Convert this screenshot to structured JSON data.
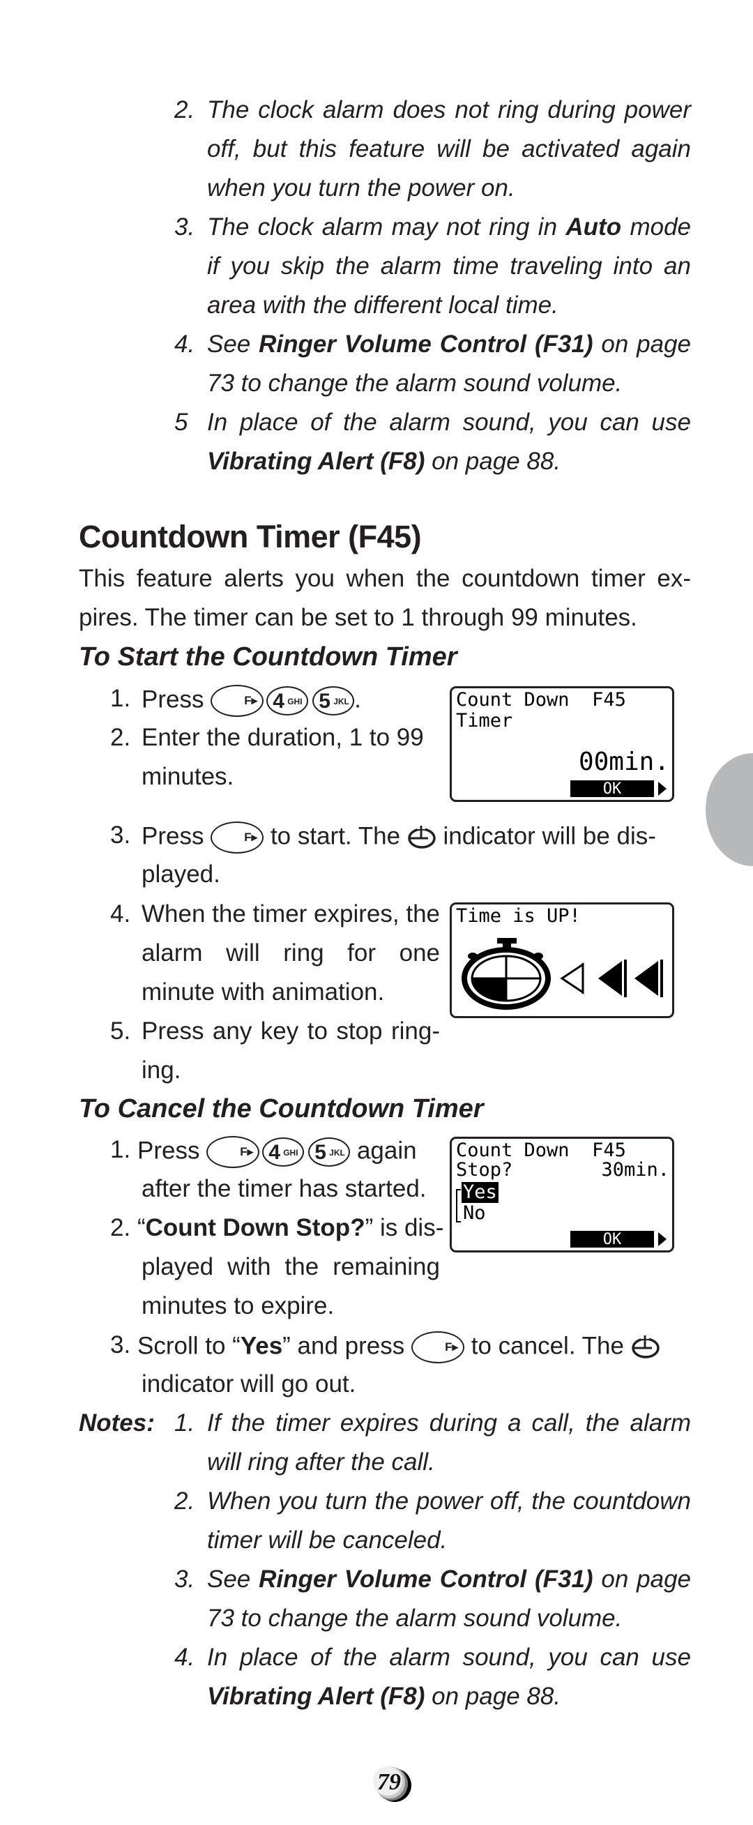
{
  "top_notes": [
    {
      "number": "2.",
      "lines": [
        "The clock alarm does not ring during power",
        "off, but this feature will be activated again",
        "when you turn the power on."
      ]
    },
    {
      "number": "3.",
      "lines_rich": [
        [
          {
            "t": "The clock alarm may not ring in "
          },
          {
            "t": "Auto",
            "b": true
          },
          {
            "t": " mode"
          }
        ],
        [
          {
            "t": "if you skip the alarm time traveling into an"
          }
        ],
        [
          {
            "t": "area with the different local time."
          }
        ]
      ]
    },
    {
      "number": "4.",
      "line1_pre": "See ",
      "line1_bold": "Ringer Volume Control (F31)",
      "line1_post": " on page",
      "line2": "73 to change the alarm sound volume."
    },
    {
      "number": "5",
      "line1": "In place of the alarm sound, you can use",
      "line2_bold": "Vibrating Alert (F8)",
      "line2_post": " on page 88."
    }
  ],
  "section": {
    "title": "Countdown Timer (F45)",
    "intro_line1": "This feature alerts you when the countdown timer ex-",
    "intro_line2": "pires. The timer can be set to 1 through 99 minutes."
  },
  "start": {
    "heading": "To Start the Countdown Timer",
    "step1_num": "1.",
    "step1_pre": "Press",
    "step1_post": ".",
    "step2_num": "2.",
    "step2_line1": "Enter the duration, 1 to 99",
    "step2_line2": "minutes.",
    "step3_num": "3.",
    "step3_pre": "Press",
    "step3_mid": "to start. The",
    "step3_post": "indicator will be dis-",
    "step3_line2": "played.",
    "step4_num": "4.",
    "step4_line1": "When the timer expires, the",
    "step4_line2": "alarm will ring for one",
    "step4_line3": "minute with animation.",
    "step5_num": "5.",
    "step5_line1": "Press any key to stop ring-",
    "step5_line2": "ing."
  },
  "cancel": {
    "heading": "To Cancel the Countdown Timer",
    "step1_num": "1.",
    "step1_pre": "Press",
    "step1_post": "again",
    "step1_line2": "after the timer has started.",
    "step2_num": "2.",
    "step2_open": "“",
    "step2_bold": "Count Down Stop?",
    "step2_close": "” is dis-",
    "step2_line2": "played with the remaining",
    "step2_line3": "minutes to expire.",
    "step3_num": "3.",
    "step3_pre": "Scroll to “",
    "step3_bold": "Yes",
    "step3_mid": "” and press",
    "step3_post": "to cancel. The",
    "step3_line2": "indicator will go out."
  },
  "keys": {
    "function_label": "F▸",
    "four_digit": "4",
    "four_letters": "GHI",
    "five_digit": "5",
    "five_letters": "JKL"
  },
  "screens": {
    "set_timer": {
      "line1": "Count Down  F45",
      "line2": "Timer",
      "value": "00min.",
      "softkey": "OK"
    },
    "time_up": {
      "line1": "Time is UP!"
    },
    "stop": {
      "line1": "Count Down  F45",
      "line2_left": "Stop?",
      "line2_right": "30min.",
      "option_selected": "Yes",
      "option_other": "No",
      "softkey": "OK"
    }
  },
  "notes": {
    "label": "Notes:",
    "items": [
      {
        "number": "1.",
        "line1": "If the timer expires during a call, the alarm",
        "line2": "will ring after the call."
      },
      {
        "number": "2.",
        "line1": "When you turn the power off, the countdown",
        "line2": "timer will be canceled."
      },
      {
        "number": "3.",
        "line1_pre": "See ",
        "line1_bold": "Ringer Volume Control (F31)",
        "line1_post": " on page",
        "line2": "73 to change the alarm sound volume."
      },
      {
        "number": "4.",
        "line1": "In place of the alarm sound, you can use",
        "line2_bold": "Vibrating Alert (F8)",
        "line2_post": " on page 88."
      }
    ]
  },
  "footer": {
    "page_number": "79"
  }
}
